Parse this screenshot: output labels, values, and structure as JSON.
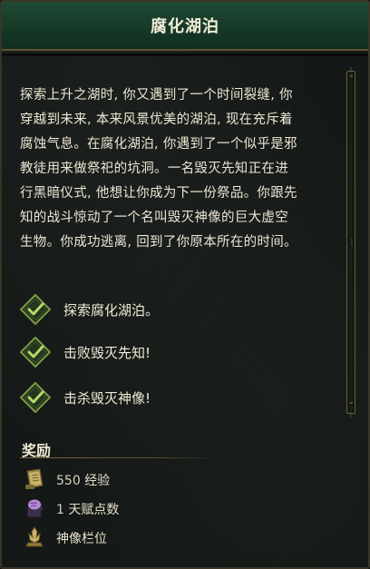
{
  "window": {
    "title": "腐化湖泊"
  },
  "quest": {
    "description_lines": [
      "探索上升之湖时, 你又遇到了一个时间裂缝, 你",
      "穿越到未来, 本来风景优美的湖泊, 现在充斥着",
      "腐蚀气息。在腐化湖泊, 你遇到了一个似乎是邪",
      "教徒用来做祭祀的坑洞。一名毁灭先知正在进",
      "行黑暗仪式, 他想让你成为下一份祭品。你跟先",
      "知的战斗惊动了一个名叫毁灭神像的巨大虚空",
      "生物。你成功逃离, 回到了你原本所在的时间。"
    ],
    "objectives": [
      {
        "label": "探索腐化湖泊。",
        "icon": "checkmark-icon",
        "completed": true
      },
      {
        "label": "击败毁灭先知!",
        "icon": "checkmark-icon",
        "completed": true
      },
      {
        "label": "击杀毁灭神像!",
        "icon": "checkmark-icon",
        "completed": true
      }
    ]
  },
  "rewards": {
    "title": "奖励",
    "items": [
      {
        "amount": "550",
        "label": "经验",
        "icon": "scroll-icon"
      },
      {
        "amount": "1",
        "label": "天赋点数",
        "icon": "brain-head-icon"
      },
      {
        "amount": "",
        "label": "神像栏位",
        "icon": "idol-icon"
      }
    ]
  },
  "colors": {
    "header_green": "#1f4a34",
    "gold_border": "#5e5330",
    "check_green": "#8fb54a",
    "text": "#ece6d4"
  }
}
